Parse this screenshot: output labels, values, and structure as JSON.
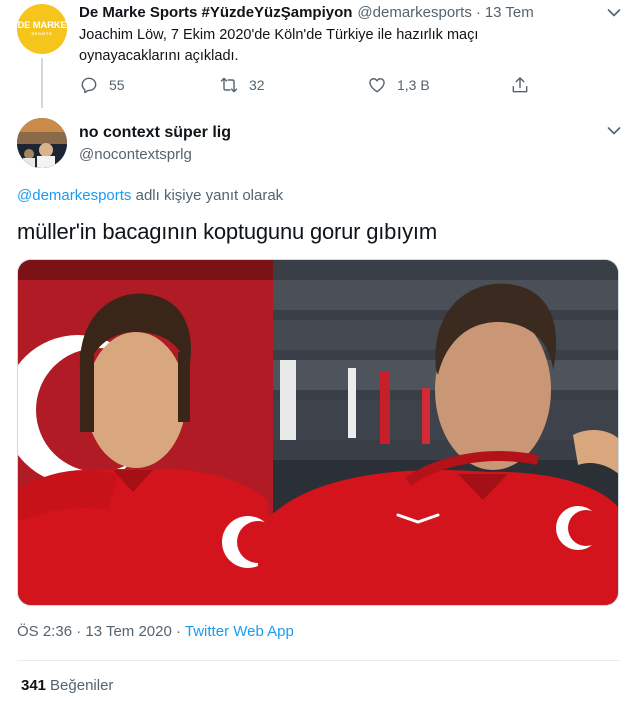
{
  "parent_tweet": {
    "avatar_logo": "DE MARKE",
    "avatar_logo_sub": "SPORTS",
    "name": "De Marke Sports #YüzdeYüzŞampiyon",
    "handle": "@demarkesports",
    "separator": "·",
    "time": "13 Tem",
    "text": "Joachim Löw, 7 Ekim 2020'de Köln'de Türkiye ile hazırlık maçı oynayacaklarını açıkladı.",
    "actions": {
      "reply_count": "55",
      "retweet_count": "32",
      "like_count": "1,3 B"
    }
  },
  "reply_tweet": {
    "name": "no context süper lig",
    "handle": "@nocontextsprlg",
    "replying_to_mention": "@demarkesports",
    "replying_to_suffix": " adlı kişiye yanıt olarak",
    "text": "müller'in bacagının koptugunu gorur gıbıyım",
    "meta_time": "ÖS 2:36 · 13 Tem 2020 · ",
    "meta_source": "Twitter Web App",
    "likes_count": "341",
    "likes_label": "Beğeniler"
  },
  "icons": {
    "reply": "reply-icon",
    "retweet": "retweet-icon",
    "like": "heart-icon",
    "share": "share-icon",
    "menu": "chevron-down-icon"
  },
  "colors": {
    "accent": "#1d9bf0",
    "secondary_text": "#536471",
    "brand_yellow": "#f5c51b",
    "jersey_red": "#d3141c"
  }
}
